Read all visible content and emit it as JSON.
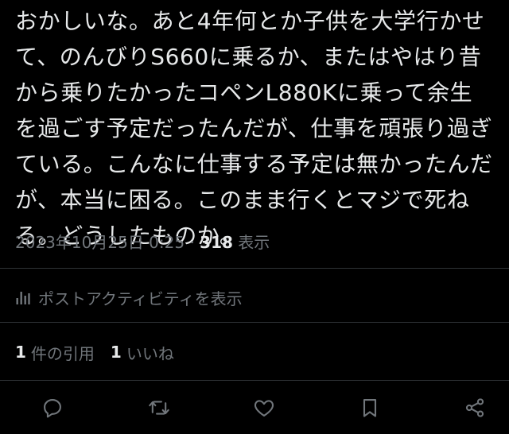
{
  "tweet": {
    "lines": [
      "おかしいな。あと4年何とか子供を大学行かせ",
      "て、のんびりS660に乗るか、またはやはり昔",
      "から乗りたかったコペンL880Kに乗って余生",
      "を過ごす予定だったんだが、仕事を頑張り過ぎ",
      "ている。こんなに仕事する予定は無かったんだ",
      "が、本当に困る。このまま行くとマジで死ね",
      "る。どうしたものか。"
    ]
  },
  "meta": {
    "timestamp": "2023年10月25日 0:25",
    "separator": "·",
    "views_count": "318",
    "views_label": "表示"
  },
  "activity": {
    "label": "ポストアクティビティを表示",
    "icon": "analytics-icon"
  },
  "counts": {
    "quotes_count": "1",
    "quotes_label": "件の引用",
    "likes_count": "1",
    "likes_label": "いいね"
  },
  "actions": {
    "icons": [
      "reply-icon",
      "repost-icon",
      "like-icon",
      "bookmark-icon",
      "share-icon"
    ]
  },
  "colors": {
    "background": "#000000",
    "text_primary": "#e7e9ea",
    "text_secondary": "#71767b",
    "divider": "#2f3336"
  }
}
